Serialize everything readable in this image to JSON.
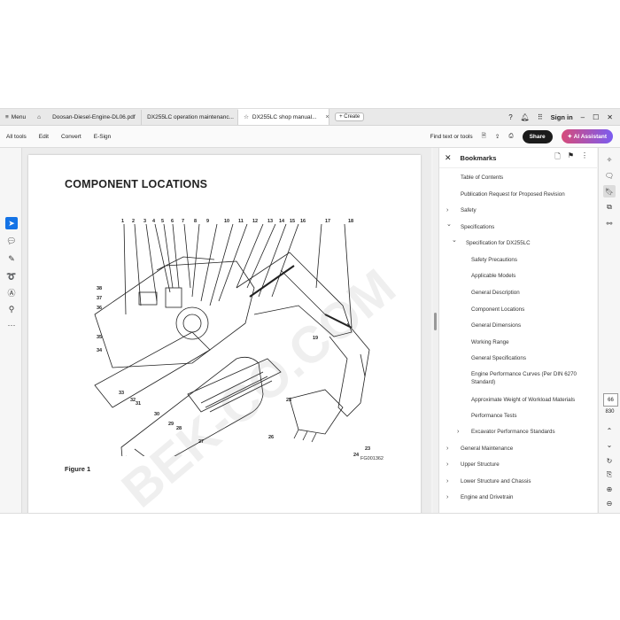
{
  "tabbar": {
    "menu_label": "Menu",
    "tabs": [
      {
        "label": "Doosan-Diesel-Engine-DL06.pdf"
      },
      {
        "label": "DX255LC operation maintenanc..."
      },
      {
        "label": "DX255LC shop manual..."
      }
    ],
    "close_glyph": "×",
    "create_label": "Create",
    "sign_in_label": "Sign in"
  },
  "toolbar": {
    "tools": [
      "All tools",
      "Edit",
      "Convert",
      "E-Sign"
    ],
    "find_label": "Find text or tools",
    "share_label": "Share",
    "ai_label": "AI Assistant"
  },
  "document": {
    "title": "COMPONENT LOCATIONS",
    "figure_label": "Figure 1",
    "figure_code": "FG001362",
    "watermark": "BEK-CO.COM",
    "callouts": [
      "1",
      "2",
      "3",
      "4",
      "5",
      "6",
      "7",
      "8",
      "9",
      "10",
      "11",
      "12",
      "13",
      "14",
      "15",
      "16",
      "17",
      "18",
      "19",
      "20",
      "21",
      "22",
      "23",
      "24",
      "25",
      "26",
      "27",
      "28",
      "29",
      "30",
      "31",
      "32",
      "33",
      "34",
      "35",
      "36",
      "37",
      "38"
    ]
  },
  "bookmarks": {
    "title": "Bookmarks",
    "items": [
      {
        "label": "Table of Contents",
        "chevron": ""
      },
      {
        "label": "Publication Request for Proposed Revision",
        "chevron": ""
      },
      {
        "label": "Safety",
        "chevron": "›"
      },
      {
        "label": "Specifications",
        "chevron": "⌄"
      },
      {
        "label": "Specification for DX255LC",
        "chevron": "⌄"
      },
      {
        "label": "Safety Precautions",
        "chevron": ""
      },
      {
        "label": "Applicable Models",
        "chevron": ""
      },
      {
        "label": "General Description",
        "chevron": ""
      },
      {
        "label": "Component Locations",
        "chevron": ""
      },
      {
        "label": "General Dimensions",
        "chevron": ""
      },
      {
        "label": "Working Range",
        "chevron": ""
      },
      {
        "label": "General Specifications",
        "chevron": ""
      },
      {
        "label": "Engine Performance Curves (Per DIN 6270 Standard)",
        "chevron": ""
      },
      {
        "label": "Approximate Weight of Workload Materials",
        "chevron": ""
      },
      {
        "label": "Performance Tests",
        "chevron": ""
      },
      {
        "label": "Excavator Performance Standards",
        "chevron": "›"
      },
      {
        "label": "General Maintenance",
        "chevron": "›"
      },
      {
        "label": "Upper Structure",
        "chevron": "›"
      },
      {
        "label": "Lower Structure and Chassis",
        "chevron": "›"
      },
      {
        "label": "Engine and Drivetrain",
        "chevron": "›"
      }
    ]
  },
  "pagenav": {
    "current": "66",
    "total": "830"
  },
  "colors": {
    "accent": "#1473e6",
    "share_bg": "#1b1b1b",
    "ai_gradient_start": "#d64b7a",
    "ai_gradient_end": "#7b5cf0"
  },
  "icons": [
    "menu-icon",
    "home-icon",
    "star-icon",
    "help-icon",
    "bell-icon",
    "apps-icon",
    "minimize-icon",
    "maximize-icon",
    "close-icon",
    "save-icon",
    "cloud-upload-icon",
    "print-icon",
    "select-cursor-icon",
    "comment-icon",
    "pen-icon",
    "lasso-icon",
    "text-select-icon",
    "stamp-icon",
    "more-icon",
    "bookmark-add-icon",
    "bookmark-icon",
    "more-vertical-icon"
  ]
}
